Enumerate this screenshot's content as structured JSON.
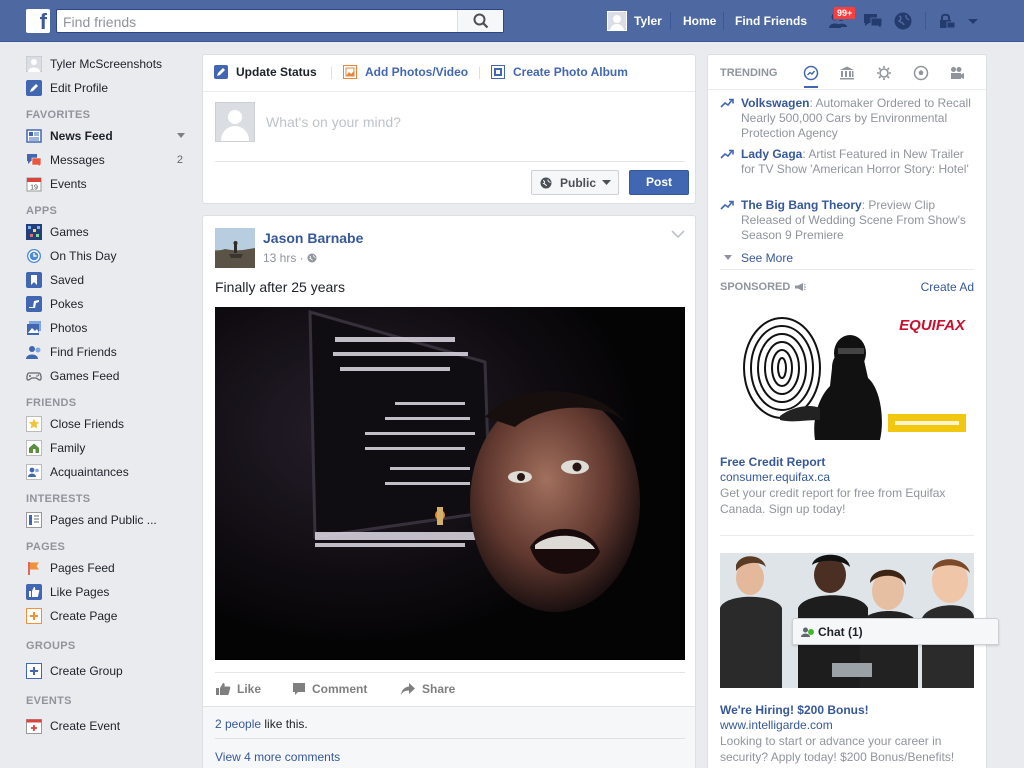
{
  "topbar": {
    "search_placeholder": "Find friends",
    "user_name": "Tyler",
    "home": "Home",
    "find_friends": "Find Friends",
    "friend_requests_badge": "99+"
  },
  "leftnav": {
    "profile_name": "Tyler McScreenshots",
    "edit_profile": "Edit Profile",
    "favorites_head": "FAVORITES",
    "favorites": [
      {
        "label": "News Feed",
        "icon": "news-feed-icon"
      },
      {
        "label": "Messages",
        "icon": "messages-icon",
        "count": "2"
      },
      {
        "label": "Events",
        "icon": "calendar-icon"
      }
    ],
    "apps_head": "APPS",
    "apps": [
      {
        "label": "Games",
        "icon": "games-icon"
      },
      {
        "label": "On This Day",
        "icon": "on-this-day-icon"
      },
      {
        "label": "Saved",
        "icon": "bookmark-icon"
      },
      {
        "label": "Pokes",
        "icon": "poke-icon"
      },
      {
        "label": "Photos",
        "icon": "photos-icon"
      },
      {
        "label": "Find Friends",
        "icon": "find-friends-icon"
      },
      {
        "label": "Games Feed",
        "icon": "gamepad-icon"
      }
    ],
    "friends_head": "FRIENDS",
    "friends": [
      {
        "label": "Close Friends",
        "icon": "star-icon"
      },
      {
        "label": "Family",
        "icon": "family-icon"
      },
      {
        "label": "Acquaintances",
        "icon": "acquaintances-icon"
      }
    ],
    "interests_head": "INTERESTS",
    "interests": [
      {
        "label": "Pages and Public ...",
        "icon": "pages-list-icon"
      }
    ],
    "pages_head": "PAGES",
    "pages": [
      {
        "label": "Pages Feed",
        "icon": "flag-icon"
      },
      {
        "label": "Like Pages",
        "icon": "thumbs-up-icon"
      },
      {
        "label": "Create Page",
        "icon": "plus-icon"
      }
    ],
    "groups_head": "GROUPS",
    "groups": [
      {
        "label": "Create Group",
        "icon": "plus-icon"
      }
    ],
    "events_head": "EVENTS",
    "events": [
      {
        "label": "Create Event",
        "icon": "plus-calendar-icon"
      }
    ]
  },
  "composer": {
    "tab_update": "Update Status",
    "tab_photos": "Add Photos/Video",
    "tab_album": "Create Photo Album",
    "placeholder": "What's on your mind?",
    "privacy": "Public",
    "post_button": "Post"
  },
  "post": {
    "author": "Jason Barnabe",
    "time": "13 hrs ·",
    "text": "Finally after 25 years",
    "like": "Like",
    "comment": "Comment",
    "share": "Share",
    "likes_count": "2 people",
    "likes_suffix": " like this.",
    "view_comments": "View 4 more comments"
  },
  "trending": {
    "head": "TRENDING",
    "items": [
      {
        "name": "Volkswagen",
        "desc": ": Automaker Ordered to Recall Nearly 500,000 Cars by Environmental Protection Agency"
      },
      {
        "name": "Lady Gaga",
        "desc": ": Artist Featured in New Trailer for TV Show 'American Horror Story: Hotel'"
      },
      {
        "name": "The Big Bang Theory",
        "desc": ": Preview Clip Released of Wedding Scene From Show's Season 9 Premiere"
      }
    ],
    "see_more": "See More"
  },
  "sponsored": {
    "head": "SPONSORED",
    "create_ad": "Create Ad",
    "ads": [
      {
        "brand": "EQUIFAX",
        "title": "Free Credit Report",
        "url": "consumer.equifax.ca",
        "desc": "Get your credit report for free from Equifax Canada. Sign up today!"
      },
      {
        "title": "We're Hiring! $200 Bonus!",
        "url": "www.intelligarde.com",
        "desc": "Looking to start or advance your career in security? Apply today! $200 Bonus/Benefits!"
      }
    ]
  },
  "chat": {
    "label": "Chat (1)"
  },
  "colors": {
    "brand_blue": "#4e69a2",
    "link_blue": "#365899",
    "page_bg": "#e9ebee",
    "badge_red": "#fa3e3e"
  }
}
